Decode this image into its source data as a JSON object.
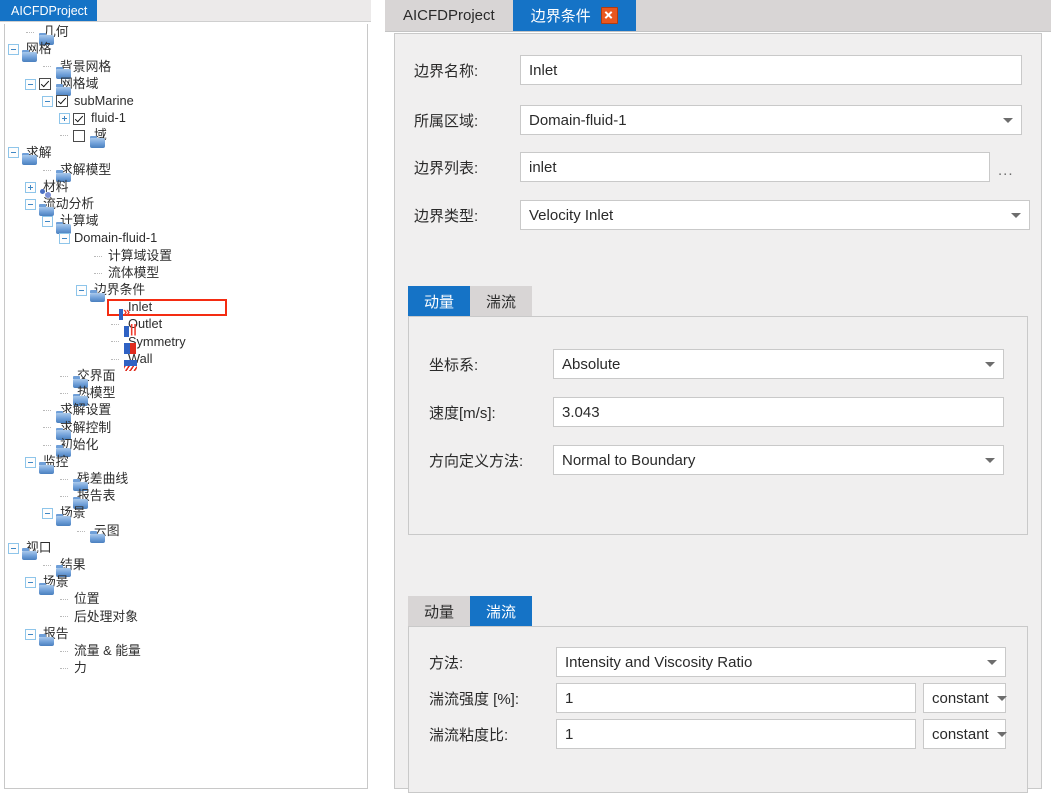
{
  "left_panel": {
    "tab_label": "AICFDProject",
    "tree": [
      {
        "label": "几何",
        "indent": 1,
        "exp": "none",
        "icon": "folder"
      },
      {
        "label": "网格",
        "indent": 0,
        "exp": "minus",
        "icon": "folder"
      },
      {
        "label": "背景网格",
        "indent": 2,
        "exp": "none",
        "icon": "folder"
      },
      {
        "label": "网格域",
        "indent": 1,
        "exp": "minus",
        "icon": "folder",
        "check": "on"
      },
      {
        "label": "subMarine",
        "indent": 2,
        "exp": "minus",
        "icon": "none",
        "check": "on"
      },
      {
        "label": "fluid-1",
        "indent": 3,
        "exp": "plus",
        "icon": "none",
        "check": "on"
      },
      {
        "label": "域",
        "indent": 3,
        "exp": "none",
        "icon": "folder",
        "check": "off"
      },
      {
        "label": "求解",
        "indent": 0,
        "exp": "minus",
        "icon": "folder"
      },
      {
        "label": "求解模型",
        "indent": 2,
        "exp": "none",
        "icon": "folder"
      },
      {
        "label": "材料",
        "indent": 1,
        "exp": "plus",
        "icon": "material"
      },
      {
        "label": "流动分析",
        "indent": 1,
        "exp": "minus",
        "icon": "folder"
      },
      {
        "label": "计算域",
        "indent": 2,
        "exp": "minus",
        "icon": "folder"
      },
      {
        "label": "Domain-fluid-1",
        "indent": 3,
        "exp": "minus",
        "icon": "none"
      },
      {
        "label": "计算域设置",
        "indent": 5,
        "exp": "none",
        "icon": "none"
      },
      {
        "label": "流体模型",
        "indent": 5,
        "exp": "none",
        "icon": "none"
      },
      {
        "label": "边界条件",
        "indent": 4,
        "exp": "minus",
        "icon": "folder"
      },
      {
        "label": "Inlet",
        "indent": 6,
        "exp": "none",
        "icon": "bc-inlet",
        "selected": true
      },
      {
        "label": "Outlet",
        "indent": 6,
        "exp": "none",
        "icon": "bc-outlet"
      },
      {
        "label": "Symmetry",
        "indent": 6,
        "exp": "none",
        "icon": "bc-sym"
      },
      {
        "label": "Wall",
        "indent": 6,
        "exp": "none",
        "icon": "bc-wall"
      },
      {
        "label": "交界面",
        "indent": 3,
        "exp": "none",
        "icon": "folder"
      },
      {
        "label": "热模型",
        "indent": 3,
        "exp": "none",
        "icon": "folder"
      },
      {
        "label": "求解设置",
        "indent": 2,
        "exp": "none",
        "icon": "folder"
      },
      {
        "label": "求解控制",
        "indent": 2,
        "exp": "none",
        "icon": "folder"
      },
      {
        "label": "初始化",
        "indent": 2,
        "exp": "none",
        "icon": "folder"
      },
      {
        "label": "监控",
        "indent": 1,
        "exp": "minus",
        "icon": "folder"
      },
      {
        "label": "残差曲线",
        "indent": 3,
        "exp": "none",
        "icon": "folder"
      },
      {
        "label": "报告表",
        "indent": 3,
        "exp": "none",
        "icon": "folder"
      },
      {
        "label": "场景",
        "indent": 2,
        "exp": "minus",
        "icon": "folder"
      },
      {
        "label": "云图",
        "indent": 4,
        "exp": "none",
        "icon": "folder"
      },
      {
        "label": "视口",
        "indent": 0,
        "exp": "minus",
        "icon": "folder"
      },
      {
        "label": "结果",
        "indent": 2,
        "exp": "none",
        "icon": "folder"
      },
      {
        "label": "场景",
        "indent": 1,
        "exp": "minus",
        "icon": "folder"
      },
      {
        "label": "位置",
        "indent": 3,
        "exp": "none",
        "icon": "none"
      },
      {
        "label": "后处理对象",
        "indent": 3,
        "exp": "none",
        "icon": "none"
      },
      {
        "label": "报告",
        "indent": 1,
        "exp": "minus",
        "icon": "folder"
      },
      {
        "label": "流量 & 能量",
        "indent": 3,
        "exp": "none",
        "icon": "none"
      },
      {
        "label": "力",
        "indent": 3,
        "exp": "none",
        "icon": "none"
      }
    ]
  },
  "right_panel": {
    "tabs": [
      {
        "label": "AICFDProject",
        "active": false,
        "closable": false
      },
      {
        "label": "边界条件",
        "active": true,
        "closable": true
      }
    ],
    "fields": [
      {
        "label": "边界名称:",
        "value": "Inlet",
        "type": "text"
      },
      {
        "label": "所属区域:",
        "value": "Domain-fluid-1",
        "type": "select"
      },
      {
        "label": "边界列表:",
        "value": "inlet",
        "type": "text-ellipsis",
        "ellipsis": "..."
      },
      {
        "label": "边界类型:",
        "value": "Velocity Inlet",
        "type": "select"
      }
    ],
    "momentum_group": {
      "tabs": [
        {
          "label": "动量",
          "active": true
        },
        {
          "label": "湍流",
          "active": false
        }
      ],
      "fields": [
        {
          "label": "坐标系:",
          "value": "Absolute",
          "type": "select"
        },
        {
          "label": "速度[m/s]:",
          "value": "3.043",
          "type": "text"
        },
        {
          "label": "方向定义方法:",
          "value": "Normal to Boundary",
          "type": "select"
        }
      ]
    },
    "turbulence_group": {
      "tabs": [
        {
          "label": "动量",
          "active": false
        },
        {
          "label": "湍流",
          "active": true
        }
      ],
      "fields": [
        {
          "label": "方法:",
          "value": "Intensity and Viscosity Ratio",
          "type": "select",
          "unit": null
        },
        {
          "label": "湍流强度 [%]:",
          "value": "1",
          "type": "text",
          "unit": "constant"
        },
        {
          "label": "湍流粘度比:",
          "value": "1",
          "type": "text",
          "unit": "constant"
        }
      ]
    }
  },
  "colors": {
    "accent_blue": "#1573c6",
    "selection_red": "#f42c12",
    "close_orange": "#e8571f",
    "tabbar_gray": "#d8d5d5",
    "panel_gray": "#f0efef"
  }
}
